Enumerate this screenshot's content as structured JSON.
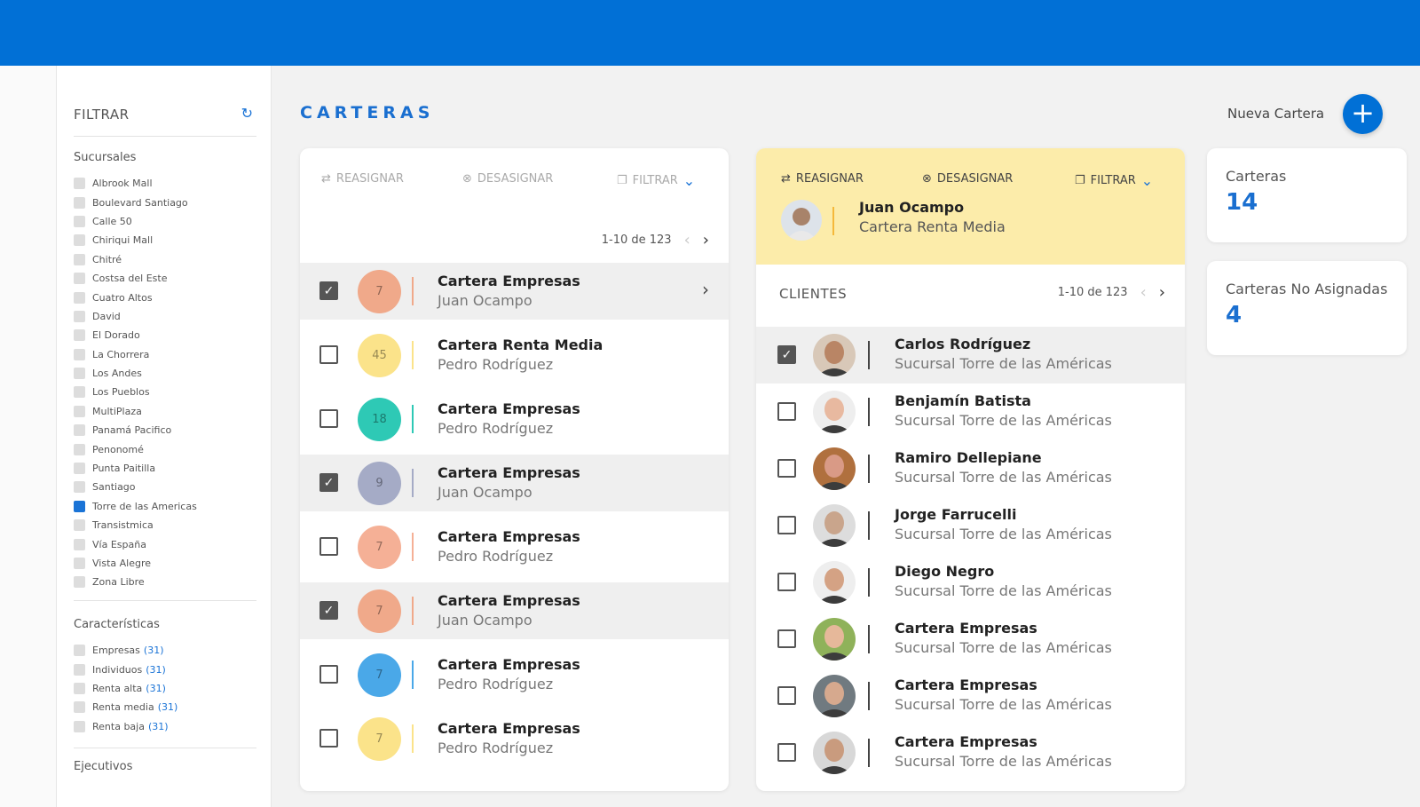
{
  "colors": {
    "topbar": "#0170d6",
    "accent": "#1a6fd0",
    "yellow": "#fcecaa"
  },
  "sidebar": {
    "title": "FILTRAR",
    "refresh_icon": "refresh-icon",
    "sucursales_title": "Sucursales",
    "sucursales": [
      {
        "label": "Albrook Mall",
        "checked": false
      },
      {
        "label": "Boulevard Santiago",
        "checked": false
      },
      {
        "label": "Calle 50",
        "checked": false
      },
      {
        "label": "Chiriqui Mall",
        "checked": false
      },
      {
        "label": "Chitré",
        "checked": false
      },
      {
        "label": "Costsa del Este",
        "checked": false
      },
      {
        "label": "Cuatro Altos",
        "checked": false
      },
      {
        "label": "David",
        "checked": false
      },
      {
        "label": "El Dorado",
        "checked": false
      },
      {
        "label": "La Chorrera",
        "checked": false
      },
      {
        "label": "Los Andes",
        "checked": false
      },
      {
        "label": "Los Pueblos",
        "checked": false
      },
      {
        "label": "MultiPlaza",
        "checked": false
      },
      {
        "label": "Panamá Pacifico",
        "checked": false
      },
      {
        "label": "Penonomé",
        "checked": false
      },
      {
        "label": "Punta Paitilla",
        "checked": false
      },
      {
        "label": "Santiago",
        "checked": false
      },
      {
        "label": "Torre de las Americas",
        "checked": true
      },
      {
        "label": "Transistmica",
        "checked": false
      },
      {
        "label": "Vía España",
        "checked": false
      },
      {
        "label": "Vista Alegre",
        "checked": false
      },
      {
        "label": "Zona Libre",
        "checked": false
      }
    ],
    "caracteristicas_title": "Características",
    "caracteristicas": [
      {
        "label": "Empresas",
        "count": "(31)"
      },
      {
        "label": "Individuos",
        "count": "(31)"
      },
      {
        "label": "Renta alta",
        "count": "(31)"
      },
      {
        "label": "Renta media",
        "count": "(31)"
      },
      {
        "label": "Renta baja",
        "count": "(31)"
      }
    ],
    "ejecutivos_title": "Ejecutivos"
  },
  "main": {
    "title": "CARTERAS",
    "new_label": "Nueva Cartera",
    "new_icon": "plus-icon"
  },
  "carteras_panel": {
    "toolbar": {
      "reasignar": "REASIGNAR",
      "desasignar": "DESASIGNAR",
      "filtrar": "FILTRAR"
    },
    "pager": "1-10 de 123",
    "rows": [
      {
        "count": "7",
        "color": "#f0a98a",
        "line": "#f0a98a",
        "title": "Cartera Empresas",
        "owner": "Juan Ocampo",
        "checked": true
      },
      {
        "count": "45",
        "color": "#fbe38a",
        "line": "#fbe38a",
        "title": "Cartera Renta Media",
        "owner": "Pedro Rodríguez",
        "checked": false
      },
      {
        "count": "18",
        "color": "#2ec9b5",
        "line": "#2ec9b5",
        "title": "Cartera Empresas",
        "owner": "Pedro Rodríguez",
        "checked": false
      },
      {
        "count": "9",
        "color": "#a5abc6",
        "line": "#a5abc6",
        "title": "Cartera Empresas",
        "owner": "Juan Ocampo",
        "checked": true
      },
      {
        "count": "7",
        "color": "#f5b096",
        "line": "#f5b096",
        "title": "Cartera Empresas",
        "owner": "Pedro Rodríguez",
        "checked": false
      },
      {
        "count": "7",
        "color": "#f0a98a",
        "line": "#f0a98a",
        "title": "Cartera Empresas",
        "owner": "Juan Ocampo",
        "checked": true
      },
      {
        "count": "7",
        "color": "#4aa8e8",
        "line": "#4aa8e8",
        "title": "Cartera Empresas",
        "owner": "Pedro Rodríguez",
        "checked": false
      },
      {
        "count": "7",
        "color": "#fbe38a",
        "line": "#fbe38a",
        "title": "Cartera Empresas",
        "owner": "Pedro Rodríguez",
        "checked": false
      }
    ]
  },
  "detail_panel": {
    "toolbar": {
      "reasignar": "REASIGNAR",
      "desasignar": "DESASIGNAR",
      "filtrar": "FILTRAR"
    },
    "owner_name": "Juan Ocampo",
    "owner_cartera": "Cartera Renta Media",
    "clientes_label": "CLIENTES",
    "pager": "1-10 de 123",
    "clients": [
      {
        "name": "Carlos Rodríguez",
        "branch": "Sucursal Torre de las Américas",
        "checked": true,
        "skin": "#b98565",
        "bg": "#d8c8b8"
      },
      {
        "name": "Benjamín Batista",
        "branch": "Sucursal Torre de las Américas",
        "checked": false,
        "skin": "#e8b9a0",
        "bg": "#eeeeee"
      },
      {
        "name": "Ramiro Dellepiane",
        "branch": "Sucursal Torre de las Américas",
        "checked": false,
        "skin": "#d99a86",
        "bg": "#b0703e"
      },
      {
        "name": "Jorge Farrucelli",
        "branch": "Sucursal Torre de las Américas",
        "checked": false,
        "skin": "#c9a58c",
        "bg": "#dddddd"
      },
      {
        "name": "Diego Negro",
        "branch": "Sucursal Torre de las Américas",
        "checked": false,
        "skin": "#d4a284",
        "bg": "#eeeeee"
      },
      {
        "name": "Cartera Empresas",
        "branch": "Sucursal Torre de las Américas",
        "checked": false,
        "skin": "#e6b89a",
        "bg": "#8fb25a"
      },
      {
        "name": "Cartera Empresas",
        "branch": "Sucursal Torre de las Américas",
        "checked": false,
        "skin": "#d6a98e",
        "bg": "#707a80"
      },
      {
        "name": "Cartera Empresas",
        "branch": "Sucursal Torre de las Américas",
        "checked": false,
        "skin": "#c99b7e",
        "bg": "#d8d8d8"
      }
    ]
  },
  "stats": [
    {
      "label": "Carteras",
      "value": "14"
    },
    {
      "label": "Carteras No Asignadas",
      "value": "4"
    }
  ]
}
